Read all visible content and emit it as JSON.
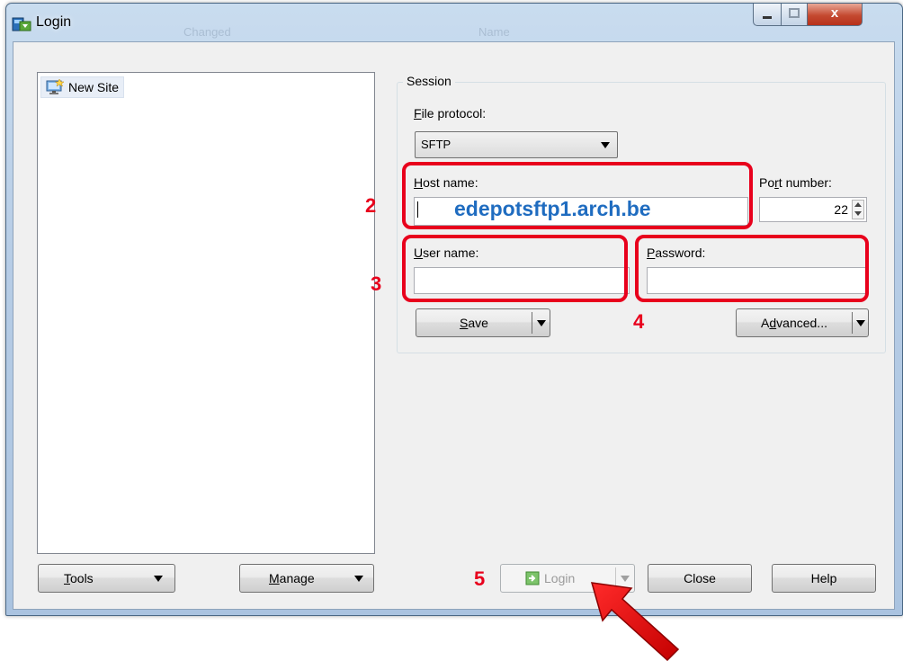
{
  "window": {
    "title": "Login",
    "ghost_text": [
      "Changed",
      "Name"
    ],
    "close_glyph": "x"
  },
  "sites": [
    {
      "label": "New Site",
      "icon": "new-site-monitor-icon"
    }
  ],
  "session": {
    "legend": "Session",
    "file_protocol_label": "File protocol:",
    "file_protocol_value": "SFTP",
    "host_name_label": "Host name:",
    "host_name_value": "edepotsftp1.arch.be",
    "port_number_label": "Port number:",
    "port_number_value": "22",
    "user_name_label": "User name:",
    "user_name_value": "",
    "password_label": "Password:",
    "password_value": "",
    "save_label": "Save",
    "advanced_label": "Advanced..."
  },
  "bottom_buttons": {
    "tools": "Tools",
    "manage": "Manage",
    "login": "Login",
    "close": "Close",
    "help": "Help"
  },
  "annotations": {
    "step2": "2",
    "step3": "3",
    "step4": "4",
    "step5": "5"
  },
  "colors": {
    "highlight": "#e8001c",
    "host_value": "#1f6cc0",
    "titlebar": "#b7cde6",
    "close_button": "#c44a31"
  }
}
